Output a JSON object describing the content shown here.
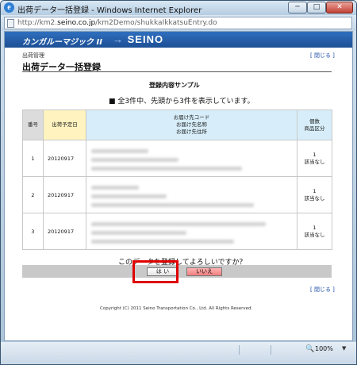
{
  "window": {
    "title": "出荷データ一括登録 - Windows Internet Explorer",
    "controls": {
      "minimize": "─",
      "maximize": "□",
      "close": "✕"
    }
  },
  "address": {
    "url_prefix": "http://km2.",
    "url_domain": "seino.co.jp",
    "url_path": "/km2Demo/shukkaIkkatsuEntry.do"
  },
  "banner": {
    "app_name": "カンガルーマジック II",
    "logo_arrow": "→",
    "logo_text": "SEINO"
  },
  "page": {
    "breadcrumb": "出荷管理",
    "close_link": "[ 閉じる ]",
    "title": "出荷データ一括登録",
    "section_title": "登録内容サンプル",
    "summary": "■ 全3件中、先頭から3件を表示しています。"
  },
  "table": {
    "headers": {
      "num": "番号",
      "date": "出荷予定日",
      "dest_line1": "お届け先コード",
      "dest_line2": "お届け先名称",
      "dest_line3": "お届け先住所",
      "qty_line1": "個数",
      "qty_line2": "商品区分"
    },
    "rows": [
      {
        "num": "1",
        "date": "20120917",
        "qty": "1",
        "category": "該当なし"
      },
      {
        "num": "2",
        "date": "20120917",
        "qty": "1",
        "category": "該当なし"
      },
      {
        "num": "3",
        "date": "20120917",
        "qty": "1",
        "category": "該当なし"
      }
    ]
  },
  "confirm": {
    "question": "このデータを登録してよろしいですか？",
    "yes": "は い",
    "no": "いいえ"
  },
  "footer": {
    "close_link": "[ 閉じる ]",
    "copyright": "Copyright (C) 2011 Seino Transportation Co., Ltd. All Rights Reserved."
  },
  "status": {
    "zoom": "100%",
    "zoom_icon": "zoom-icon"
  },
  "colors": {
    "banner": "#2f6fbe",
    "highlight": "#e00000",
    "no_button": "#f07f7f",
    "date_header": "#fff3bf",
    "dest_header": "#d7eefa"
  }
}
